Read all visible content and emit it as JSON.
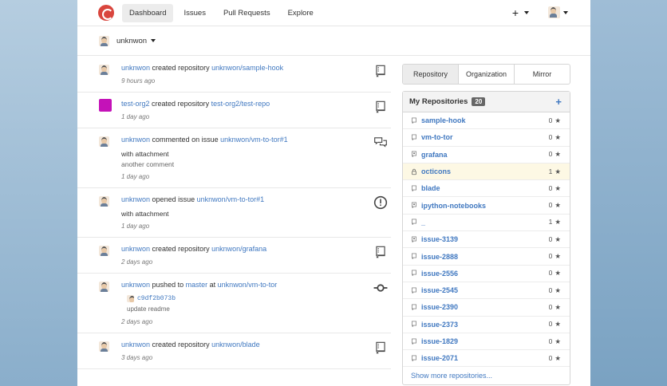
{
  "nav": {
    "items": [
      "Dashboard",
      "Issues",
      "Pull Requests",
      "Explore"
    ]
  },
  "context": {
    "user": "unknwon"
  },
  "feed": [
    {
      "user": "unknwon",
      "action": "created repository",
      "target": "unknwon/sample-hook",
      "time": "9 hours ago",
      "icon": "repo-icon",
      "avatar": "person"
    },
    {
      "user": "test-org2",
      "action": "created repository",
      "target": "test-org2/test-repo",
      "time": "1 day ago",
      "icon": "repo-icon",
      "avatar": "purple"
    },
    {
      "user": "unknwon",
      "action": "commented on issue",
      "target": "unknwon/vm-to-tor#1",
      "extra1": "with attachment",
      "extra2": "another comment",
      "time": "1 day ago",
      "icon": "comment-discussion-icon",
      "avatar": "person"
    },
    {
      "user": "unknwon",
      "action": "opened issue",
      "target": "unknwon/vm-to-tor#1",
      "extra1": "with attachment",
      "time": "1 day ago",
      "icon": "issue-opened-icon",
      "avatar": "person"
    },
    {
      "user": "unknwon",
      "action": "created repository",
      "target": "unknwon/grafana",
      "time": "2 days ago",
      "icon": "repo-icon",
      "avatar": "person"
    },
    {
      "user": "unknwon",
      "action": "pushed to",
      "branch": "master",
      "at": "at",
      "target": "unknwon/vm-to-tor",
      "sha": "c9df2b073b",
      "message": "update readme",
      "time": "2 days ago",
      "icon": "git-commit-icon",
      "avatar": "person"
    },
    {
      "user": "unknwon",
      "action": "created repository",
      "target": "unknwon/blade",
      "time": "3 days ago",
      "icon": "repo-icon",
      "avatar": "person"
    }
  ],
  "repos": {
    "tabs": [
      "Repository",
      "Organization",
      "Mirror"
    ],
    "title": "My Repositories",
    "count": "20",
    "items": [
      {
        "name": "sample-hook",
        "stars": "0",
        "icon": "repo-icon"
      },
      {
        "name": "vm-to-tor",
        "stars": "0",
        "icon": "repo-icon"
      },
      {
        "name": "grafana",
        "stars": "0",
        "icon": "repo-forked-icon"
      },
      {
        "name": "octicons",
        "stars": "1",
        "icon": "lock-icon"
      },
      {
        "name": "blade",
        "stars": "0",
        "icon": "repo-icon"
      },
      {
        "name": "ipython-notebooks",
        "stars": "0",
        "icon": "repo-forked-icon"
      },
      {
        "name": "_",
        "stars": "1",
        "icon": "repo-icon"
      },
      {
        "name": "issue-3139",
        "stars": "0",
        "icon": "repo-forked-icon"
      },
      {
        "name": "issue-2888",
        "stars": "0",
        "icon": "repo-icon"
      },
      {
        "name": "issue-2556",
        "stars": "0",
        "icon": "repo-icon"
      },
      {
        "name": "issue-2545",
        "stars": "0",
        "icon": "repo-icon"
      },
      {
        "name": "issue-2390",
        "stars": "0",
        "icon": "repo-icon"
      },
      {
        "name": "issue-2373",
        "stars": "0",
        "icon": "repo-icon"
      },
      {
        "name": "issue-1829",
        "stars": "0",
        "icon": "repo-icon"
      },
      {
        "name": "issue-2071",
        "stars": "0",
        "icon": "repo-icon"
      }
    ],
    "show_more": "Show more repositories..."
  }
}
